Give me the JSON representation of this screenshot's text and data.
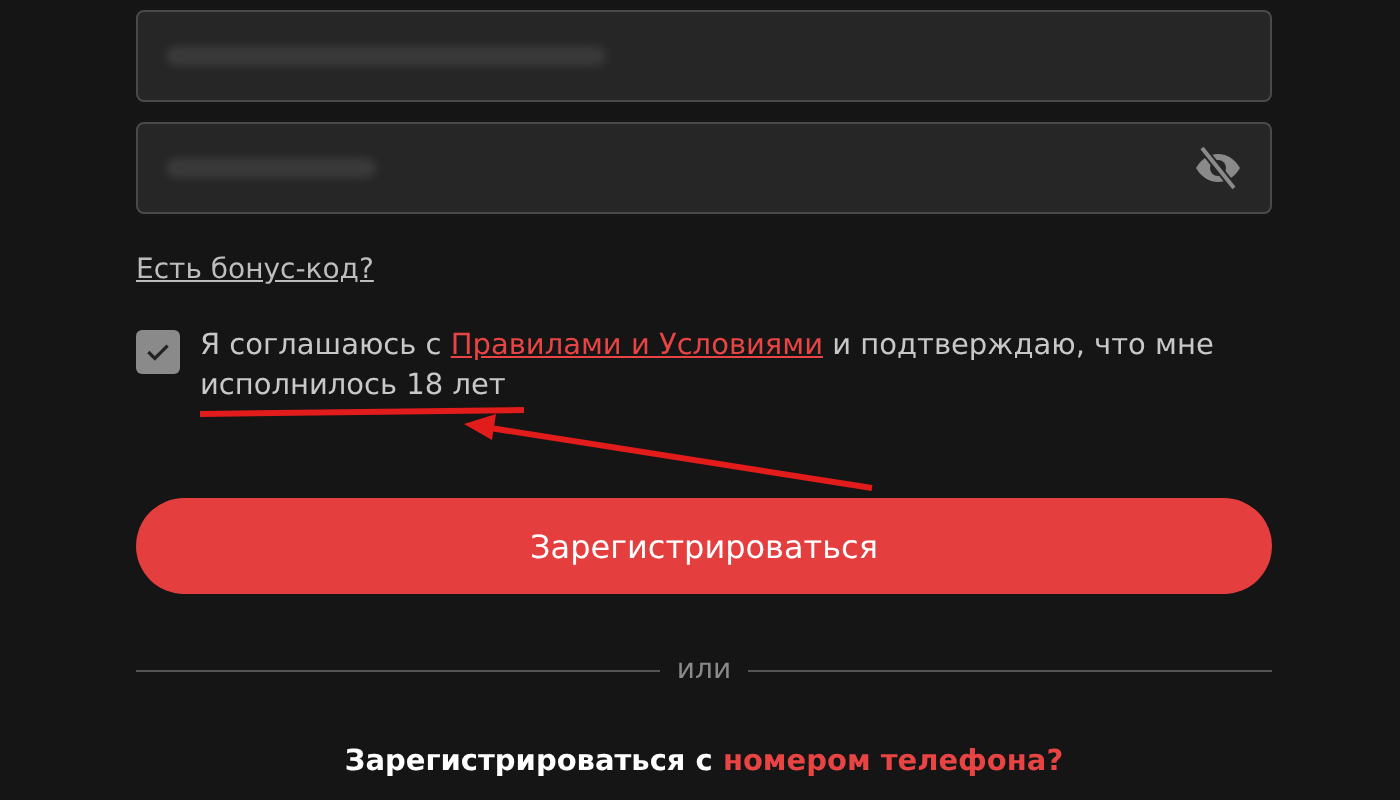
{
  "fields": [
    {
      "kind": "text"
    },
    {
      "kind": "password"
    }
  ],
  "bonus_link": "Есть бонус-код?",
  "agreement": {
    "checked": true,
    "before": "Я соглашаюсь с",
    "link": "Правилами и Условиями",
    "after": "и подтверждаю, что мне исполнилось 18 лет"
  },
  "register_button": "Зарегистрироваться",
  "divider": "или",
  "phone_prompt": {
    "text": "Зарегистрироваться с",
    "link": "номером телефона?"
  }
}
